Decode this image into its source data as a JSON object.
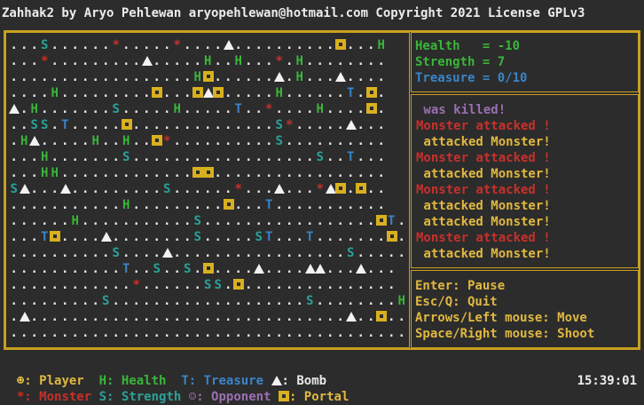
{
  "title": "Zahhak2 by Aryo Pehlewan aryopehlewan@hotmail.com Copyright 2021 License GPLv3",
  "stats": {
    "health": "Health   = -10",
    "strength": "Strength = 7",
    "treasure": "Treasure = 0/10"
  },
  "log": [
    {
      "text": " was killed!",
      "color": "#9b6fb0"
    },
    {
      "text": "Monster attacked !",
      "color": "#c8302a"
    },
    {
      "text": " attacked Monster!",
      "color": "#e0b840"
    },
    {
      "text": "Monster attacked !",
      "color": "#c8302a"
    },
    {
      "text": " attacked Monster!",
      "color": "#e0b840"
    },
    {
      "text": "Monster attacked !",
      "color": "#c8302a"
    },
    {
      "text": " attacked Monster!",
      "color": "#e0b840"
    },
    {
      "text": " attacked Monster!",
      "color": "#e0b840"
    },
    {
      "text": "Monster attacked !",
      "color": "#c8302a"
    },
    {
      "text": " attacked Monster!",
      "color": "#e0b840"
    }
  ],
  "help": [
    "Enter: Pause",
    "Esc/Q: Quit",
    "Arrows/Left mouse: Move",
    "Space/Right mouse: Shoot"
  ],
  "legend": {
    "player": ": Player",
    "health_key": "H",
    "health": ": Health",
    "treasure_key": "T",
    "treasure": ": Treasure",
    "bomb": ": Bomb",
    "monster": ": Monster",
    "strength_key": "S",
    "strength": ": Strength",
    "opponent": ": Opponent",
    "portal": ": Portal"
  },
  "clock": "15:39:01",
  "board": [
    "...S......*.....*....A..........P...H",
    "...*.........A.....H..H...*.H........",
    "..................HP......A.H...A....",
    "....H.........P...PAP.....H......T.P.",
    "A.H.......S.....H.....T..*....H....P.",
    "..SS.T.....P..............S*.....A...",
    ".HA.....H..H..P*..........S..........",
    "...H.......S..................S..T...",
    "...HH.............PP.................",
    "SA...A.........S......*...A...*AP.P..",
    "...........H.........P...T...........",
    "......H...........S.................PT.P",
    "...TP....A........S.....ST...T.......P.",
    "..........S....A.................S......",
    "...........T..S..S.P....A....AA...A...",
    "............*......SS.P...............",
    ".........S...................S........H",
    ".A...............................A..P..",
    "........................................"
  ]
}
